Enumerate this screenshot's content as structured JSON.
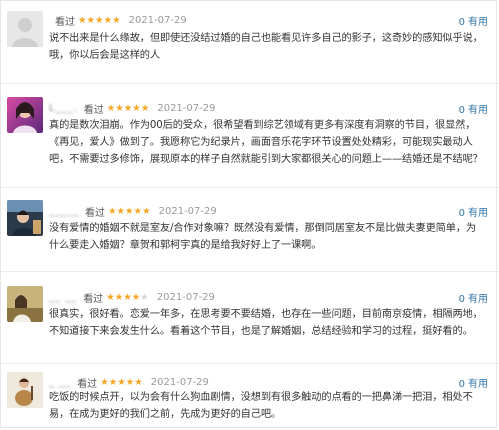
{
  "reviews": [
    {
      "username": "",
      "verb": "看过",
      "rating": 5,
      "stars": "★★★★★",
      "date": "2021-07-29",
      "useful_count": "0",
      "useful_label": "有用",
      "text": "说不出来是什么缘故，但即使还没结过婚的自己也能看见许多自己的影子，这奇妙的感知似乎说，哦，你以后会是这样的人"
    },
    {
      "username": "L___.",
      "verb": "看过",
      "rating": 5,
      "stars": "★★★★★",
      "date": "2021-07-29",
      "useful_count": "0",
      "useful_label": "有用",
      "text": "真的是数次泪崩。作为00后的受众，很希望看到综艺领域有更多有深度有洞察的节目，很显然，《再见，爱人》做到了。我愿称它为纪录片，画面音乐花字环节设置处处精彩，可能现实最动人吧，不需要过多修饰，展现原本的样子自然就能引到大家都很关心的问题上——结婚还是不结呢？"
    },
    {
      "username": "_____",
      "verb": "看过",
      "rating": 5,
      "stars": "★★★★★",
      "date": "2021-07-29",
      "useful_count": "0",
      "useful_label": "有用",
      "text": "没有爱情的婚姻不就是室友/合作对象嘛？既然没有爱情，那倒同居室友不是比做夫妻更简单，为什么要走入婚姻？章贺和郭柯宇真的是给我好好上了一课啊。"
    },
    {
      "username": "__ __",
      "verb": "看过",
      "rating": 4,
      "stars": "★★★★",
      "stars_off": "★",
      "date": "2021-07-29",
      "useful_count": "0",
      "useful_label": "有用",
      "text": "很真实，很好看。恋爱一年多，在思考要不要结婚，也存在一些问题，目前南京疫情，相隔两地，不知道接下来会发生什么。看着这个节目，也是了解婚姻，总结经验和学习的过程，挺好看的。"
    },
    {
      "username": "_ __",
      "verb": "看过",
      "rating": 5,
      "stars": "★★★★★",
      "date": "2021-07-29",
      "useful_count": "0",
      "useful_label": "有用",
      "text": "吃饭的时候点开，以为会有什么狗血剧情，没想到有很多触动的点看的一把鼻涕一把泪，相处不易，在成为更好的我们之前，先成为更好的自己吧。"
    }
  ]
}
